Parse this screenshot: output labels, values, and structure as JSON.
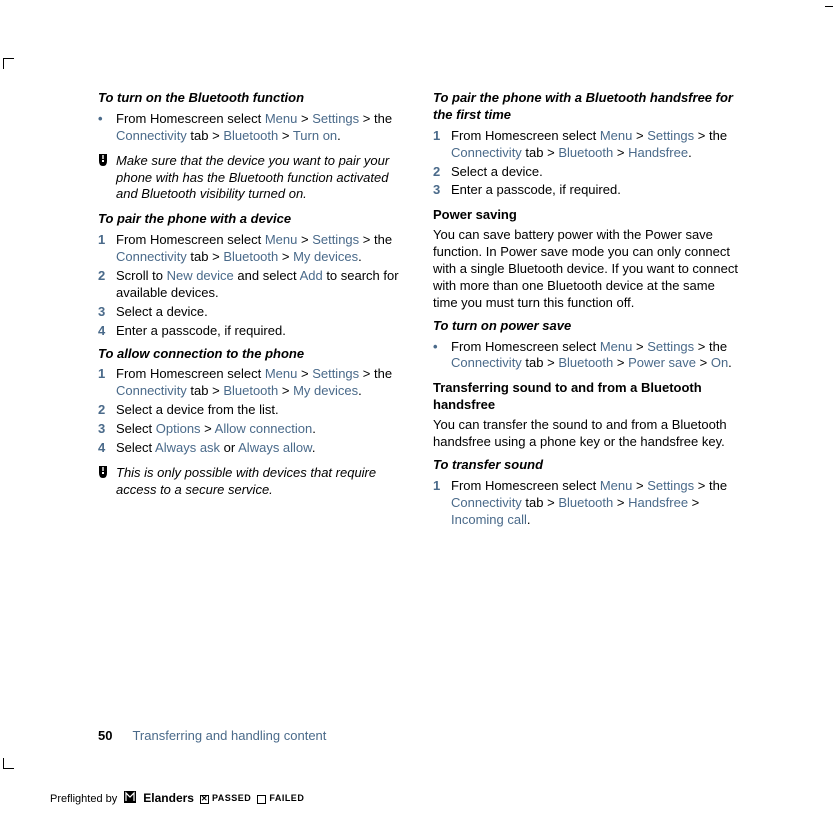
{
  "left": {
    "h1": "To turn on the Bluetooth function",
    "b1_pre": "From Homescreen select ",
    "b1_menu": "Menu",
    "b1_gt1": " > ",
    "b1_settings": "Settings",
    "b1_gt2": " > the ",
    "b1_conn": "Connectivity",
    "b1_tab": " tab > ",
    "b1_bt": "Bluetooth",
    "b1_gt3": " > ",
    "b1_turnon": "Turn on",
    "b1_dot": ".",
    "note1": "Make sure that the device you want to pair your phone with has the Bluetooth function activated and Bluetooth visibility turned on.",
    "h2": "To pair the phone with a device",
    "s1_pre": "From Homescreen select ",
    "s1_menu": "Menu",
    "s1_gt1": " > ",
    "s1_settings": "Settings",
    "s1_gt2": " > the ",
    "s1_conn": "Connectivity",
    "s1_tab": " tab > ",
    "s1_bt": "Bluetooth",
    "s1_gt3": " > ",
    "s1_mydev": "My devices",
    "s1_dot": ".",
    "s2_pre": "Scroll to ",
    "s2_newdev": "New device",
    "s2_mid": " and select ",
    "s2_add": "Add",
    "s2_post": " to search for available devices.",
    "s3": "Select a device.",
    "s4": "Enter a passcode, if required.",
    "h3": "To allow connection to the phone",
    "a1_pre": "From Homescreen select ",
    "a1_menu": "Menu",
    "a1_gt1": " > ",
    "a1_settings": "Settings",
    "a1_gt2": " > the ",
    "a1_conn": "Connectivity",
    "a1_tab": " tab > ",
    "a1_bt": "Bluetooth",
    "a1_gt3": " > ",
    "a1_mydev": "My devices",
    "a1_dot": ".",
    "a2": "Select a device from the list.",
    "a3_pre": "Select ",
    "a3_opt": "Options",
    "a3_gt": " > ",
    "a3_allow": "Allow connection",
    "a3_dot": ".",
    "a4_pre": "Select ",
    "a4_ask": "Always ask",
    "a4_or": " or ",
    "a4_allow": "Always allow",
    "a4_dot": ".",
    "note2": "This is only possible with devices that require access to a secure service."
  },
  "right": {
    "h1": "To pair the phone with a Bluetooth handsfree for the first time",
    "p1_pre": "From Homescreen select ",
    "p1_menu": "Menu",
    "p1_gt1": " > ",
    "p1_settings": "Settings",
    "p1_gt2": " > the ",
    "p1_conn": "Connectivity",
    "p1_tab": " tab > ",
    "p1_bt": "Bluetooth",
    "p1_gt3": " > ",
    "p1_hf": "Handsfree",
    "p1_dot": ".",
    "p2": "Select a device.",
    "p3": "Enter a passcode, if required.",
    "h2": "Power saving",
    "pspar": "You can save battery power with the Power save function. In Power save mode you can only connect with a single Bluetooth device. If you want to connect with more than one Bluetooth device at the same time you must turn this function off.",
    "h3": "To turn on power save",
    "ps_pre": "From Homescreen select ",
    "ps_menu": "Menu",
    "ps_gt1": " > ",
    "ps_settings": "Settings",
    "ps_gt2": " > the ",
    "ps_conn": "Connectivity",
    "ps_tab": " tab > ",
    "ps_bt": "Bluetooth",
    "ps_gt3": " > ",
    "ps_ps": "Power save",
    "ps_gt4": " > ",
    "ps_on": "On",
    "ps_dot": ".",
    "h4": "Transferring sound to and from a Bluetooth handsfree",
    "tspar": "You can transfer the sound to and from a Bluetooth handsfree using a phone key or the handsfree key.",
    "h5": "To transfer sound",
    "ts_pre": "From Homescreen select ",
    "ts_menu": "Menu",
    "ts_gt1": " > ",
    "ts_settings": "Settings",
    "ts_gt2": " > the ",
    "ts_conn": "Connectivity",
    "ts_tab": " tab > ",
    "ts_bt": "Bluetooth",
    "ts_gt3": " > ",
    "ts_hf": "Handsfree",
    "ts_gt4": " > ",
    "ts_ic": "Incoming call",
    "ts_dot": "."
  },
  "footer": {
    "page": "50",
    "section": "Transferring and handling content"
  },
  "preflight": {
    "label": "Preflighted by",
    "brand": "Elanders",
    "passed": "PASSED",
    "failed": "FAILED",
    "x": "✕"
  },
  "nums": {
    "n1": "1",
    "n2": "2",
    "n3": "3",
    "n4": "4"
  }
}
